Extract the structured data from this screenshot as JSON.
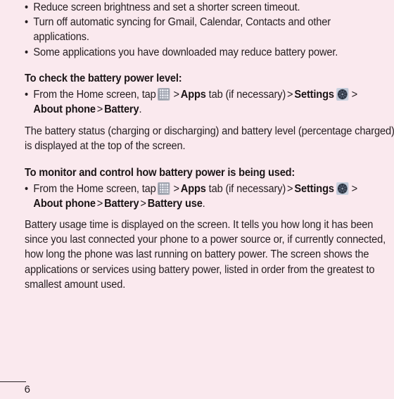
{
  "page": {
    "background_color": "#fae9ee",
    "text_color": "#241d20",
    "number": "6"
  },
  "tips_list": [
    "Reduce screen brightness and set a shorter screen timeout.",
    "Turn off automatic syncing for Gmail, Calendar, Contacts and other applications.",
    "Some applications you have downloaded may reduce battery power."
  ],
  "section_check": {
    "heading": "To check the battery power level:",
    "step": {
      "lead": "From the Home screen, tap",
      "apps_icon": "apps-grid-icon",
      "sep1": ">",
      "apps_label": "Apps",
      "tab_note": "tab (if necessary)",
      "sep2": ">",
      "settings_label": "Settings",
      "settings_icon": "gear-icon",
      "sep3": ">",
      "about_phone": "About phone",
      "sep4": ">",
      "battery": "Battery",
      "period": "."
    },
    "paragraph": "The battery status (charging or discharging) and battery level (percentage charged) is displayed at the top of the screen."
  },
  "section_monitor": {
    "heading": "To monitor and control how battery power is being used:",
    "step": {
      "lead": "From the Home screen, tap",
      "apps_icon": "apps-grid-icon",
      "sep1": ">",
      "apps_label": "Apps",
      "tab_note": "tab (if necessary)",
      "sep2": ">",
      "settings_label": "Settings",
      "settings_icon": "gear-icon",
      "sep3": ">",
      "about_phone": "About phone",
      "sep4": ">",
      "battery": "Battery",
      "sep5": ">",
      "battery_use": "Battery use",
      "period": "."
    },
    "paragraph": "Battery usage time is displayed on the screen. It tells you how long it has been since you last connected your phone to a power source or, if currently connected, how long the phone was last running on battery power. The screen shows the applications or services using battery power, listed in order from the greatest to smallest amount used."
  },
  "bullet_glyph": "•"
}
